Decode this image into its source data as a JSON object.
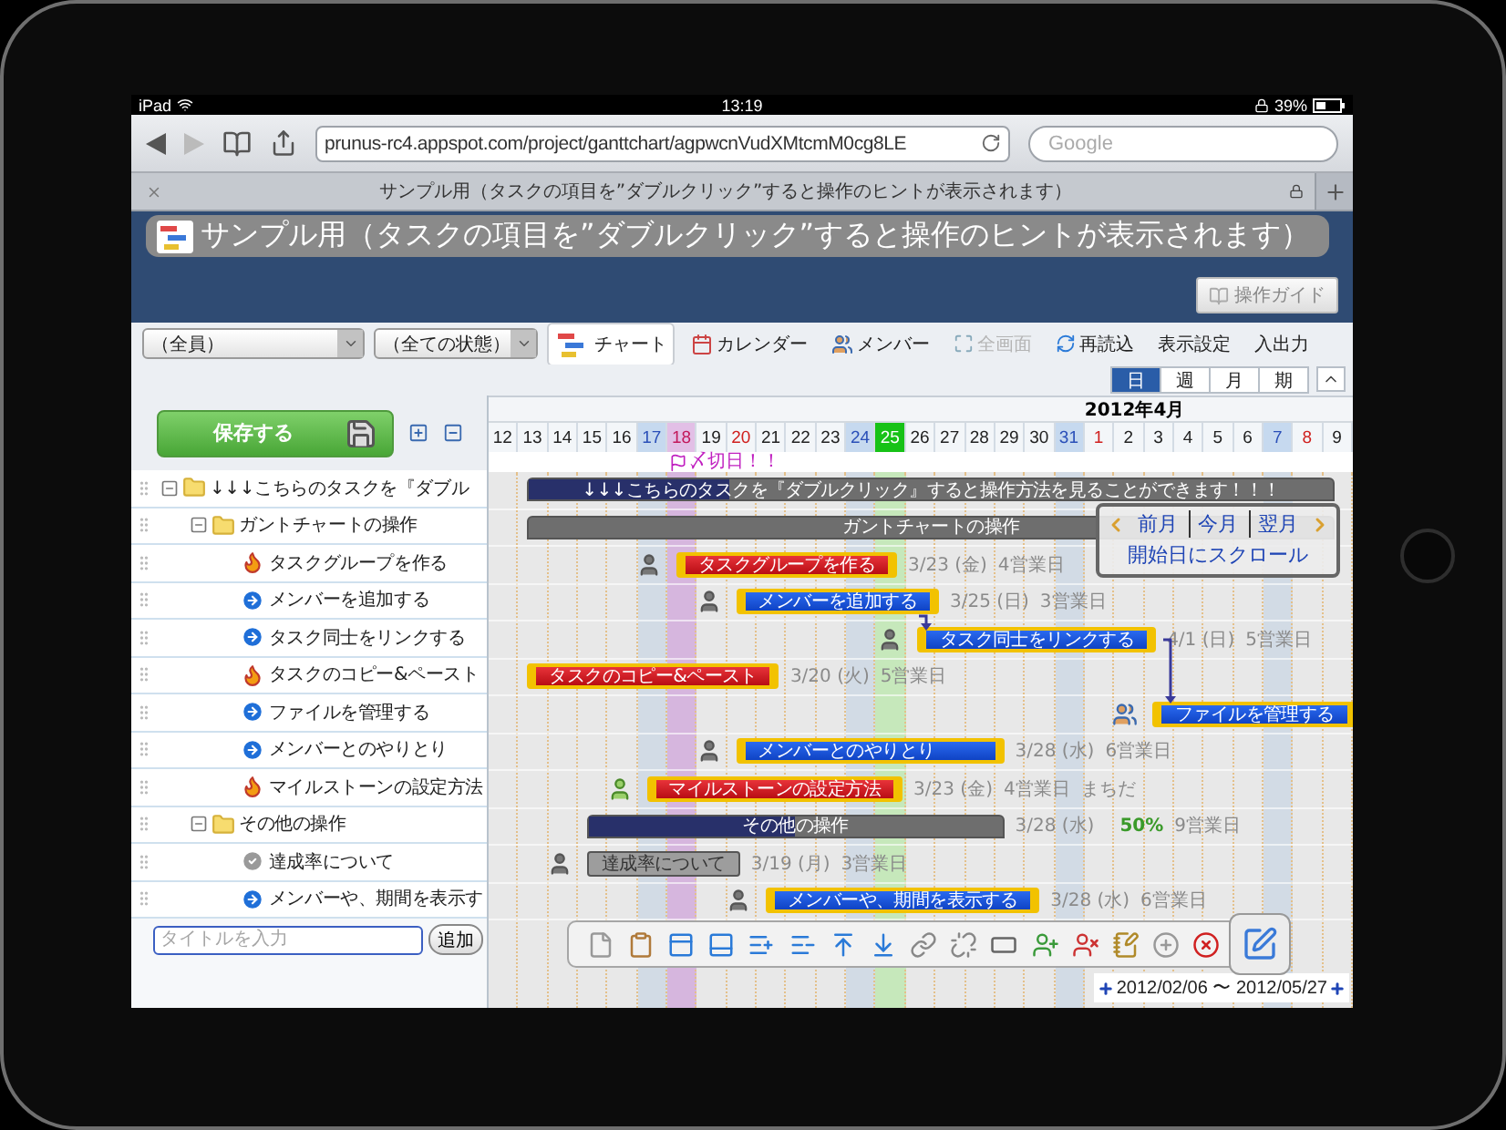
{
  "status_bar": {
    "device": "iPad",
    "time": "13:19",
    "battery": "39%"
  },
  "browser": {
    "url": "prunus-rc4.appspot.com/project/ganttchart/agpwcnVudXMtcmM0cg8LE",
    "search": {
      "placeholder": "Google"
    },
    "tab_title": "サンプル用（タスクの項目を”ダブルクリック”すると操作のヒントが表示されます）"
  },
  "header": {
    "title": "サンプル用（タスクの項目を”ダブルクリック”すると操作のヒントが表示されます）",
    "guide_button": "操作ガイド"
  },
  "toolbar": {
    "filters": [
      {
        "value": "（全員）"
      },
      {
        "value": "（全ての状態）"
      }
    ],
    "views": [
      {
        "label": "チャート",
        "selected": true,
        "disabled": false
      },
      {
        "label": "カレンダー",
        "selected": false,
        "disabled": false
      },
      {
        "label": "メンバー",
        "selected": false,
        "disabled": false
      },
      {
        "label": "全画面",
        "selected": false,
        "disabled": true
      },
      {
        "label": "再読込",
        "selected": false,
        "disabled": false
      },
      {
        "label": "表示設定",
        "selected": false,
        "disabled": false
      },
      {
        "label": "入出力",
        "selected": false,
        "disabled": false
      }
    ]
  },
  "scale_tabs": [
    {
      "label": "日",
      "selected": true
    },
    {
      "label": "週",
      "selected": false
    },
    {
      "label": "月",
      "selected": false
    },
    {
      "label": "期",
      "selected": false
    }
  ],
  "save_button": "保存する",
  "tree": [
    {
      "label": "↓↓↓こちらのタスクを『ダブル",
      "kind": "group",
      "expanded": true,
      "children": [
        {
          "label": "ガントチャートの操作",
          "kind": "group",
          "expanded": true,
          "children": [
            {
              "label": "タスクグループを作る",
              "kind": "urgent"
            },
            {
              "label": "メンバーを追加する",
              "kind": "normal"
            },
            {
              "label": "タスク同士をリンクする",
              "kind": "normal"
            },
            {
              "label": "タスクのコピー&ペースト",
              "kind": "urgent"
            },
            {
              "label": "ファイルを管理する",
              "kind": "normal"
            },
            {
              "label": "メンバーとのやりとり",
              "kind": "normal"
            },
            {
              "label": "マイルストーンの設定方法",
              "kind": "urgent"
            }
          ]
        },
        {
          "label": "その他の操作",
          "kind": "group",
          "expanded": true,
          "children": [
            {
              "label": "達成率について",
              "kind": "done"
            },
            {
              "label": "メンバーや、期間を表示す",
              "kind": "normal"
            }
          ]
        }
      ]
    }
  ],
  "new_task": {
    "placeholder": "タイトルを入力",
    "button": "追加"
  },
  "timeline": {
    "month": "2012年4月",
    "deadline": "〆切日！！",
    "days": [
      {
        "label": "12",
        "kind": "weekday"
      },
      {
        "label": "13",
        "kind": "weekday"
      },
      {
        "label": "14",
        "kind": "weekday"
      },
      {
        "label": "15",
        "kind": "weekday"
      },
      {
        "label": "16",
        "kind": "weekday"
      },
      {
        "label": "17",
        "kind": "saturday"
      },
      {
        "label": "18",
        "kind": "deadline"
      },
      {
        "label": "19",
        "kind": "weekday"
      },
      {
        "label": "20",
        "kind": "holiday"
      },
      {
        "label": "21",
        "kind": "weekday"
      },
      {
        "label": "22",
        "kind": "weekday"
      },
      {
        "label": "23",
        "kind": "weekday"
      },
      {
        "label": "24",
        "kind": "saturday"
      },
      {
        "label": "25",
        "kind": "today"
      },
      {
        "label": "26",
        "kind": "weekday"
      },
      {
        "label": "27",
        "kind": "weekday"
      },
      {
        "label": "28",
        "kind": "weekday"
      },
      {
        "label": "29",
        "kind": "weekday"
      },
      {
        "label": "30",
        "kind": "weekday"
      },
      {
        "label": "31",
        "kind": "saturday"
      },
      {
        "label": "1",
        "kind": "sunday"
      },
      {
        "label": "2",
        "kind": "weekday"
      },
      {
        "label": "3",
        "kind": "weekday"
      },
      {
        "label": "4",
        "kind": "weekday"
      },
      {
        "label": "5",
        "kind": "weekday"
      },
      {
        "label": "6",
        "kind": "weekday"
      },
      {
        "label": "7",
        "kind": "saturday"
      },
      {
        "label": "8",
        "kind": "sunday"
      },
      {
        "label": "9",
        "kind": "weekday"
      }
    ]
  },
  "gantt_rows": [
    {
      "kind": "group",
      "label": "↓↓↓こちらのタスクを『ダブルクリック』すると操作方法を見ることができます！！！",
      "level": 0.25
    },
    {
      "kind": "group",
      "label": "ガントチャートの操作"
    },
    {
      "kind": "urgent",
      "label": "タスクグループを作る",
      "assignee": {
        "kind": "single"
      },
      "date": "3/23 (金)",
      "workdays": "4営業日"
    },
    {
      "kind": "normal",
      "label": "メンバーを追加する",
      "assignee": {
        "kind": "single"
      },
      "date": "3/25 (日)",
      "workdays": "3営業日"
    },
    {
      "kind": "normal",
      "label": "タスク同士をリンクする",
      "assignee": {
        "kind": "single"
      },
      "date": "4/1 (日)",
      "workdays": "5営業日"
    },
    {
      "kind": "urgent",
      "label": "タスクのコピー&ペースト",
      "date": "3/20 (火)",
      "workdays": "5営業日"
    },
    {
      "kind": "normal",
      "label": "ファイルを管理する",
      "assignee": {
        "kind": "team"
      }
    },
    {
      "kind": "normal",
      "label": "メンバーとのやりとり",
      "assignee": {
        "kind": "single"
      },
      "date": "3/28 (水)",
      "workdays": "6営業日"
    },
    {
      "kind": "urgent",
      "label": "マイルストーンの設定方法",
      "assignee": {
        "kind": "self"
      },
      "date": "3/23 (金)",
      "workdays": "4営業日",
      "note": "まちだ"
    },
    {
      "kind": "group",
      "label": "その他の操作",
      "level": 0.5,
      "date": "3/28 (水)",
      "progress": "50%",
      "workdays": "9営業日"
    },
    {
      "kind": "done",
      "label": "達成率について",
      "assignee": {
        "kind": "single"
      },
      "date": "3/19 (月)",
      "workdays": "3営業日"
    },
    {
      "kind": "normal",
      "label": "メンバーや、期間を表示する",
      "assignee": {
        "kind": "single"
      },
      "date": "3/28 (水)",
      "workdays": "6営業日"
    }
  ],
  "navigator": {
    "links": [
      "前月",
      "今月",
      "翌月"
    ],
    "scroll_link": "開始日にスクロール"
  },
  "range": "2012/02/06 〜 2012/05/27"
}
